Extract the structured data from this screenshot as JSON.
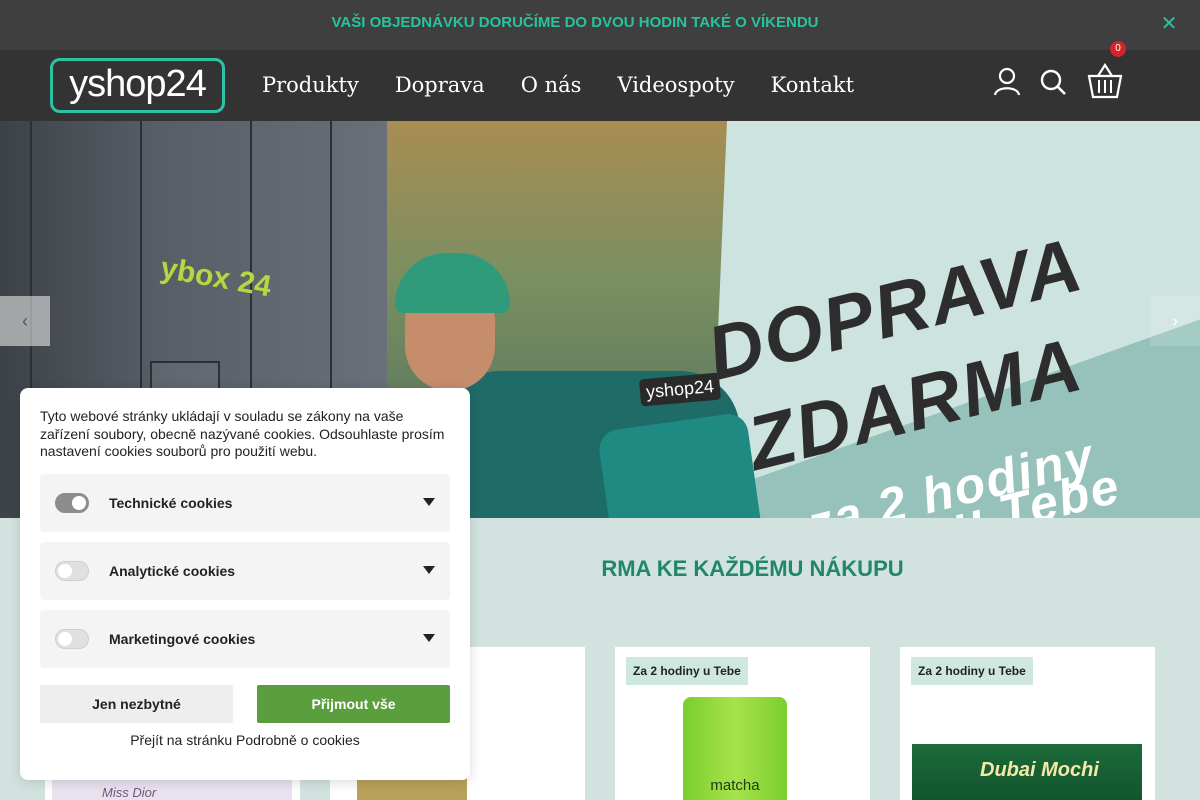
{
  "promo": {
    "text": "VAŠI OBJEDNÁVKU DORUČÍME DO DVOU HODIN TAKÉ O VÍKENDU",
    "close": "✕"
  },
  "header": {
    "logo": "yshop24",
    "nav": [
      "Produkty",
      "Doprava",
      "O nás",
      "Videospoty",
      "Kontakt"
    ],
    "cart_count": "0",
    "icons": [
      "user-icon",
      "search-icon",
      "basket-icon"
    ]
  },
  "hero": {
    "locker_brand": "ybox 24",
    "backpack_brand": "yshop24",
    "line1": "DOPRAVA",
    "line2": "ZDARMA",
    "line3": "za 2 hodiny",
    "line4": "u Tebe",
    "prev": "‹",
    "next": "›"
  },
  "section": {
    "title_visible": "RMA KE KAŽDÉMU NÁKUPU"
  },
  "products": [
    {
      "tag": "",
      "label": "Miss Dior"
    },
    {
      "tag": "",
      "label": ""
    },
    {
      "tag": "Za 2 hodiny u Tebe",
      "label": "matcha"
    },
    {
      "tag": "Za 2 hodiny u Tebe",
      "label": "Dubai Mochi"
    }
  ],
  "cookies": {
    "intro": "Tyto webové stránky ukládají v souladu se zákony na vaše zařízení soubory, obecně nazývané cookies. Odsouhlaste prosím nastavení cookies souborů pro použití webu.",
    "categories": [
      {
        "label": "Technické cookies",
        "enabled": true
      },
      {
        "label": "Analytické cookies",
        "enabled": false
      },
      {
        "label": "Marketingové cookies",
        "enabled": false
      }
    ],
    "btn_necessary": "Jen nezbytné",
    "btn_accept": "Přijmout vše",
    "details_link": "Přejít na stránku Podrobně o cookies"
  },
  "colors": {
    "accent_teal": "#27c39f",
    "header_bg": "#333333",
    "accept_green": "#5a9e3d",
    "section_title": "#22866a",
    "badge_red": "#d1252b"
  }
}
